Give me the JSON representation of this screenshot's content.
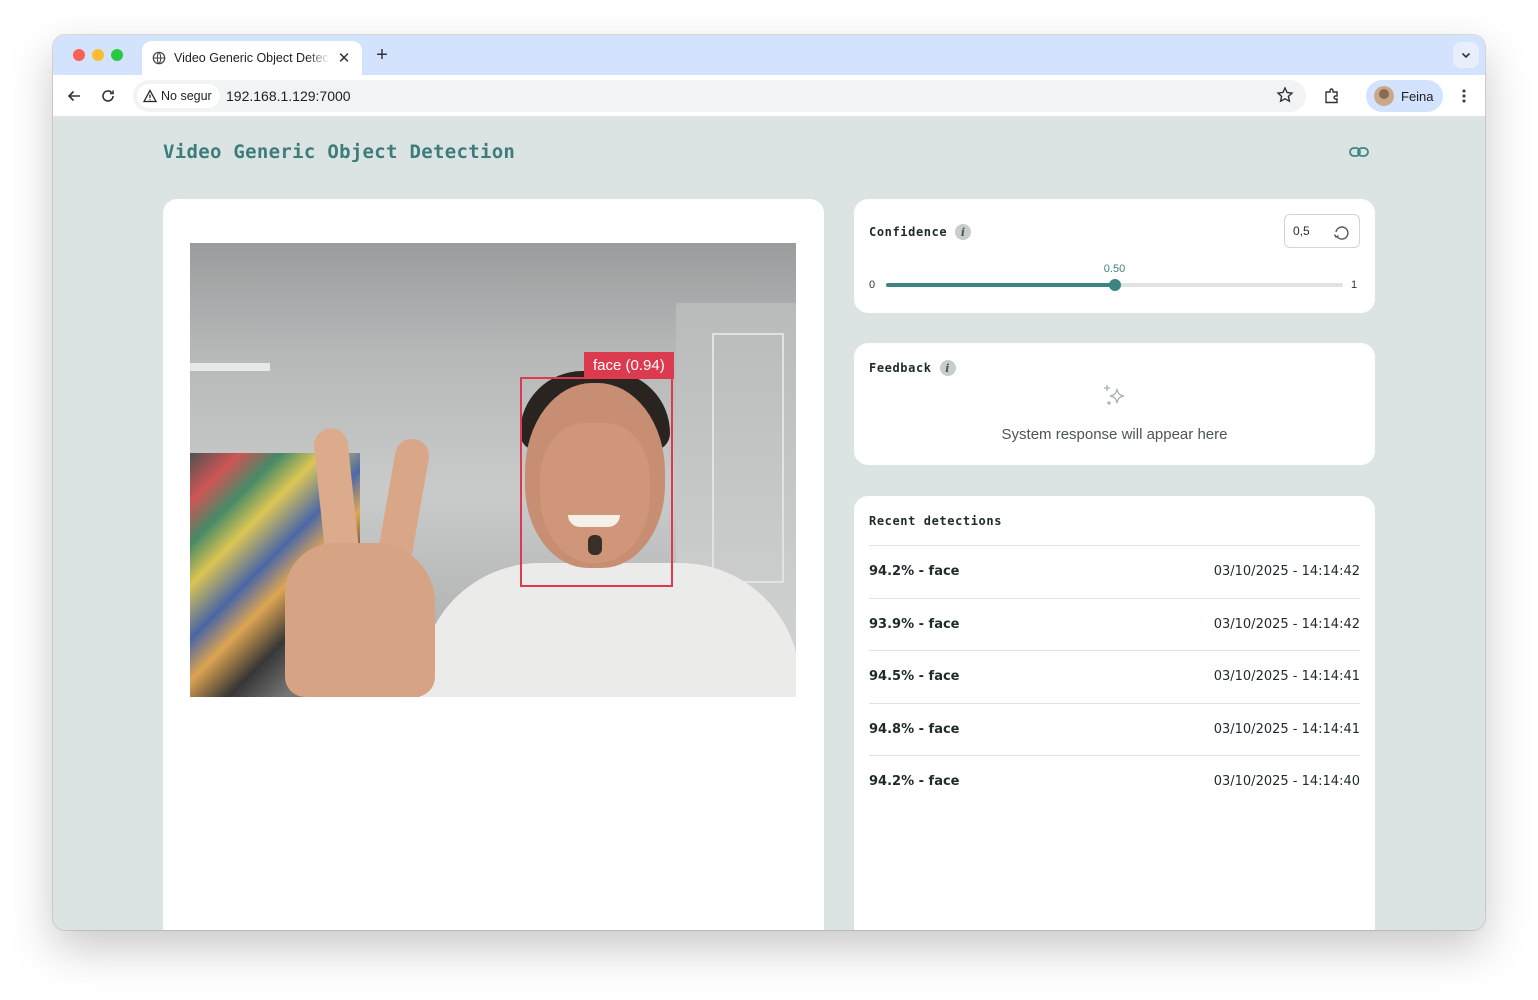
{
  "browser": {
    "tab_title": "Video Generic Object Detection",
    "security_label": "No segur",
    "url": "192.168.1.129:7000",
    "profile_name": "Feina"
  },
  "page": {
    "title": "Video Generic Object Detection"
  },
  "video": {
    "detection_label": "face (0.94)",
    "box_color": "#dc3b4f"
  },
  "confidence": {
    "title": "Confidence",
    "input_value": "0,5",
    "slider_min": "0",
    "slider_max": "1",
    "slider_value_label": "0.50",
    "slider_value": 0.5
  },
  "feedback": {
    "title": "Feedback",
    "placeholder": "System response will appear here"
  },
  "recent": {
    "title": "Recent detections",
    "items": [
      {
        "label": "94.2% - face",
        "time": "03/10/2025 - 14:14:42"
      },
      {
        "label": "93.9% - face",
        "time": "03/10/2025 - 14:14:42"
      },
      {
        "label": "94.5% - face",
        "time": "03/10/2025 - 14:14:41"
      },
      {
        "label": "94.8% - face",
        "time": "03/10/2025 - 14:14:41"
      },
      {
        "label": "94.2% - face",
        "time": "03/10/2025 - 14:14:40"
      }
    ]
  },
  "colors": {
    "accent": "#3c8582",
    "page_bg": "#dbe4e3",
    "title": "#3c7d7c"
  },
  "icons": [
    "globe-icon",
    "close-icon",
    "plus-icon",
    "chevron-down-icon",
    "back-icon",
    "reload-icon",
    "warning-icon",
    "star-icon",
    "extensions-icon",
    "kebab-menu-icon",
    "link-icon",
    "info-icon",
    "reset-icon",
    "sparkle-icon"
  ]
}
